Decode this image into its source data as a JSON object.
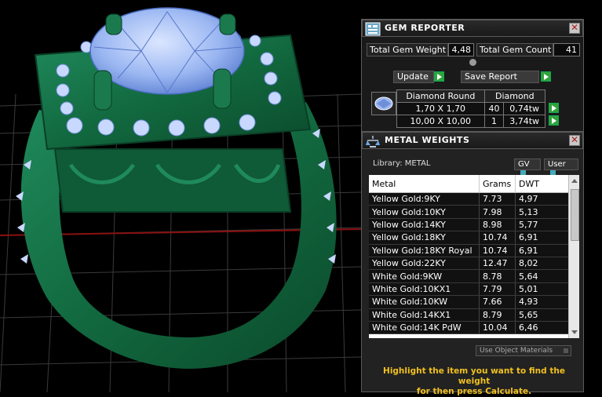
{
  "gem_reporter": {
    "title": "GEM REPORTER",
    "total_weight_label": "Total Gem Weight",
    "total_weight_value": "4,48",
    "total_count_label": "Total Gem Count",
    "total_count_value": "41",
    "update_label": "Update",
    "save_report_label": "Save Report",
    "gem_type_header": "Diamond Round",
    "gem_material_header": "Diamond",
    "rows": [
      {
        "size": "1,70 X 1,70",
        "count": "40",
        "weight": "0,74tw"
      },
      {
        "size": "10,00 X 10,00",
        "count": "1",
        "weight": "3,74tw"
      }
    ]
  },
  "metal_weights": {
    "title": "METAL WEIGHTS",
    "library_label": "Library: METAL",
    "gv_label": "GV",
    "user_label": "User",
    "columns": [
      "Metal",
      "Grams",
      "DWT"
    ],
    "rows": [
      {
        "metal": "Yellow Gold:9KY",
        "grams": "7.73",
        "dwt": "4,97"
      },
      {
        "metal": "Yellow Gold:10KY",
        "grams": "7.98",
        "dwt": "5,13"
      },
      {
        "metal": "Yellow Gold:14KY",
        "grams": "8.98",
        "dwt": "5,77"
      },
      {
        "metal": "Yellow Gold:18KY",
        "grams": "10.74",
        "dwt": "6,91"
      },
      {
        "metal": "Yellow Gold:18KY Royal",
        "grams": "10.74",
        "dwt": "6,91"
      },
      {
        "metal": "Yellow Gold:22KY",
        "grams": "12.47",
        "dwt": "8,02"
      },
      {
        "metal": "White Gold:9KW",
        "grams": "8.78",
        "dwt": "5,64"
      },
      {
        "metal": "White Gold:10KX1",
        "grams": "7.79",
        "dwt": "5,01"
      },
      {
        "metal": "White Gold:10KW",
        "grams": "7.66",
        "dwt": "4,93"
      },
      {
        "metal": "White Gold:14KX1",
        "grams": "8.79",
        "dwt": "5,65"
      },
      {
        "metal": "White Gold:14K PdW",
        "grams": "10.04",
        "dwt": "6,46"
      }
    ],
    "use_object_materials_label": "Use Object Materials",
    "hint_line1": "Highlight the item you want to find the weight",
    "hint_line2": "for then press Calculate."
  },
  "colors": {
    "ring_green": "#14704a",
    "gem_blue": "#8fb1f0",
    "grid_red": "#8a1010",
    "hint_yellow": "#f0c020"
  },
  "icons": [
    "gem-reporter-icon",
    "metal-weights-icon",
    "gem-thumbnail-icon"
  ]
}
